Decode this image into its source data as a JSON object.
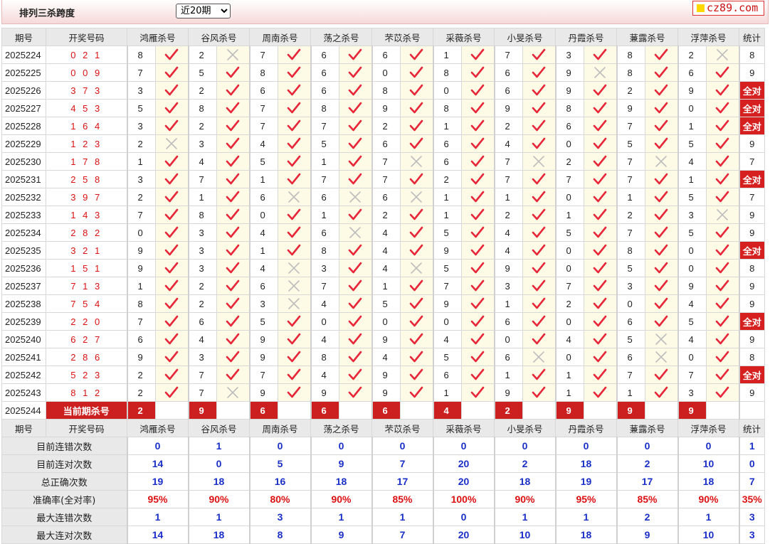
{
  "header": {
    "title": "排列三杀跨度",
    "period_select": "近20期",
    "logo": "cz89.com"
  },
  "columns": {
    "period": "期号",
    "draw": "开奖号码",
    "experts": [
      "鸿雁杀号",
      "谷风杀号",
      "周南杀号",
      "荡之杀号",
      "芣苡杀号",
      "采薇杀号",
      "小旻杀号",
      "丹霞杀号",
      "蒹露杀号",
      "浮萍杀号"
    ],
    "stat": "统计"
  },
  "rows": [
    {
      "period": "2025224",
      "draw": "021",
      "kills": [
        8,
        2,
        7,
        6,
        6,
        1,
        7,
        3,
        8,
        2
      ],
      "ok": [
        1,
        0,
        1,
        1,
        1,
        1,
        1,
        1,
        1,
        0
      ],
      "stat": "8"
    },
    {
      "period": "2025225",
      "draw": "009",
      "kills": [
        7,
        5,
        8,
        6,
        0,
        8,
        6,
        9,
        8,
        6
      ],
      "ok": [
        1,
        1,
        1,
        1,
        1,
        1,
        1,
        0,
        1,
        1
      ],
      "stat": "9"
    },
    {
      "period": "2025226",
      "draw": "373",
      "kills": [
        3,
        2,
        6,
        6,
        8,
        0,
        6,
        9,
        2,
        9
      ],
      "ok": [
        1,
        1,
        1,
        1,
        1,
        1,
        1,
        1,
        1,
        1
      ],
      "stat": "全对"
    },
    {
      "period": "2025227",
      "draw": "453",
      "kills": [
        5,
        8,
        7,
        8,
        9,
        8,
        9,
        8,
        9,
        0
      ],
      "ok": [
        1,
        1,
        1,
        1,
        1,
        1,
        1,
        1,
        1,
        1
      ],
      "stat": "全对"
    },
    {
      "period": "2025228",
      "draw": "164",
      "kills": [
        3,
        2,
        7,
        7,
        2,
        1,
        2,
        6,
        7,
        1
      ],
      "ok": [
        1,
        1,
        1,
        1,
        1,
        1,
        1,
        1,
        1,
        1
      ],
      "stat": "全对"
    },
    {
      "period": "2025229",
      "draw": "123",
      "kills": [
        2,
        3,
        4,
        5,
        6,
        6,
        4,
        0,
        5,
        5
      ],
      "ok": [
        0,
        1,
        1,
        1,
        1,
        1,
        1,
        1,
        1,
        1
      ],
      "stat": "9"
    },
    {
      "period": "2025230",
      "draw": "178",
      "kills": [
        1,
        4,
        5,
        1,
        7,
        6,
        7,
        2,
        7,
        4
      ],
      "ok": [
        1,
        1,
        1,
        1,
        0,
        1,
        0,
        1,
        0,
        1
      ],
      "stat": "7"
    },
    {
      "period": "2025231",
      "draw": "258",
      "kills": [
        3,
        7,
        1,
        7,
        7,
        2,
        7,
        7,
        7,
        1
      ],
      "ok": [
        1,
        1,
        1,
        1,
        1,
        1,
        1,
        1,
        1,
        1
      ],
      "stat": "全对"
    },
    {
      "period": "2025232",
      "draw": "397",
      "kills": [
        2,
        1,
        6,
        6,
        6,
        1,
        1,
        0,
        1,
        5
      ],
      "ok": [
        1,
        1,
        0,
        0,
        0,
        1,
        1,
        1,
        1,
        1
      ],
      "stat": "7"
    },
    {
      "period": "2025233",
      "draw": "143",
      "kills": [
        7,
        8,
        0,
        1,
        2,
        1,
        2,
        1,
        2,
        3
      ],
      "ok": [
        1,
        1,
        1,
        1,
        1,
        1,
        1,
        1,
        1,
        0
      ],
      "stat": "9"
    },
    {
      "period": "2025234",
      "draw": "282",
      "kills": [
        0,
        3,
        4,
        6,
        4,
        5,
        4,
        5,
        7,
        5
      ],
      "ok": [
        1,
        1,
        1,
        0,
        1,
        1,
        1,
        1,
        1,
        1
      ],
      "stat": "9"
    },
    {
      "period": "2025235",
      "draw": "321",
      "kills": [
        9,
        3,
        1,
        8,
        4,
        9,
        4,
        0,
        8,
        0
      ],
      "ok": [
        1,
        1,
        1,
        1,
        1,
        1,
        1,
        1,
        1,
        1
      ],
      "stat": "全对"
    },
    {
      "period": "2025236",
      "draw": "151",
      "kills": [
        9,
        3,
        4,
        3,
        4,
        5,
        9,
        0,
        5,
        0
      ],
      "ok": [
        1,
        1,
        0,
        1,
        0,
        1,
        1,
        1,
        1,
        1
      ],
      "stat": "8"
    },
    {
      "period": "2025237",
      "draw": "713",
      "kills": [
        1,
        2,
        6,
        7,
        1,
        7,
        3,
        7,
        3,
        9
      ],
      "ok": [
        1,
        1,
        0,
        1,
        1,
        1,
        1,
        1,
        1,
        1
      ],
      "stat": "9"
    },
    {
      "period": "2025238",
      "draw": "754",
      "kills": [
        8,
        2,
        3,
        4,
        5,
        9,
        1,
        2,
        0,
        4
      ],
      "ok": [
        1,
        1,
        0,
        1,
        1,
        1,
        1,
        1,
        1,
        1
      ],
      "stat": "9"
    },
    {
      "period": "2025239",
      "draw": "220",
      "kills": [
        7,
        6,
        5,
        0,
        0,
        0,
        6,
        0,
        6,
        5
      ],
      "ok": [
        1,
        1,
        1,
        1,
        1,
        1,
        1,
        1,
        1,
        1
      ],
      "stat": "全对"
    },
    {
      "period": "2025240",
      "draw": "627",
      "kills": [
        6,
        4,
        9,
        4,
        9,
        4,
        0,
        4,
        5,
        4
      ],
      "ok": [
        1,
        1,
        1,
        1,
        1,
        1,
        1,
        1,
        0,
        1
      ],
      "stat": "9"
    },
    {
      "period": "2025241",
      "draw": "286",
      "kills": [
        9,
        3,
        9,
        8,
        4,
        5,
        6,
        0,
        6,
        0
      ],
      "ok": [
        1,
        1,
        1,
        1,
        1,
        1,
        0,
        1,
        0,
        1
      ],
      "stat": "8"
    },
    {
      "period": "2025242",
      "draw": "523",
      "kills": [
        2,
        7,
        7,
        4,
        9,
        6,
        1,
        1,
        7,
        7
      ],
      "ok": [
        1,
        1,
        1,
        1,
        1,
        1,
        1,
        1,
        1,
        1
      ],
      "stat": "全对"
    },
    {
      "period": "2025243",
      "draw": "812",
      "kills": [
        2,
        7,
        9,
        9,
        9,
        1,
        9,
        1,
        1,
        3
      ],
      "ok": [
        1,
        0,
        1,
        1,
        1,
        1,
        1,
        1,
        1,
        1
      ],
      "stat": "9"
    }
  ],
  "current": {
    "period": "2025244",
    "label": "当前期杀号",
    "kills": [
      "2",
      "9",
      "6",
      "6",
      "6",
      "4",
      "2",
      "9",
      "9",
      "9"
    ]
  },
  "stats": [
    {
      "label": "目前连错次数",
      "values": [
        "0",
        "1",
        "0",
        "0",
        "0",
        "0",
        "0",
        "0",
        "0",
        "0",
        "1"
      ]
    },
    {
      "label": "目前连对次数",
      "values": [
        "14",
        "0",
        "5",
        "9",
        "7",
        "20",
        "2",
        "18",
        "2",
        "10",
        "0"
      ]
    },
    {
      "label": "总正确次数",
      "values": [
        "19",
        "18",
        "16",
        "18",
        "17",
        "20",
        "18",
        "19",
        "17",
        "18",
        "7"
      ]
    },
    {
      "label": "准确率(全对率)",
      "values": [
        "95%",
        "90%",
        "80%",
        "90%",
        "85%",
        "100%",
        "90%",
        "95%",
        "85%",
        "90%",
        "35%"
      ]
    },
    {
      "label": "最大连错次数",
      "values": [
        "1",
        "1",
        "3",
        "1",
        "1",
        "0",
        "1",
        "1",
        "2",
        "1",
        "3"
      ]
    },
    {
      "label": "最大连对次数",
      "values": [
        "14",
        "18",
        "8",
        "9",
        "7",
        "20",
        "10",
        "18",
        "9",
        "10",
        "3"
      ]
    }
  ],
  "icons": {
    "correct": "check-icon",
    "wrong": "cross-icon"
  },
  "colors": {
    "red": "#d61f1f",
    "blue": "#1a2fc8",
    "check": "#e8263a",
    "cross": "#bdbdbd"
  }
}
